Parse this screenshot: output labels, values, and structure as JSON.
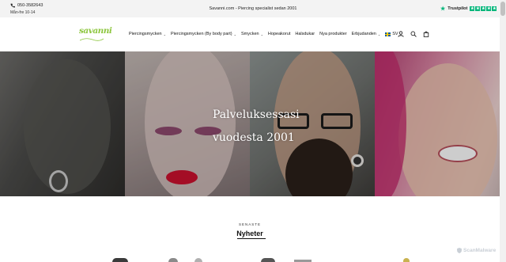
{
  "announcement": {
    "phone": "050-3582643",
    "hours": "Mån-fre 10-14",
    "message": "Savanni.com - Piercing specialist sedan 2001",
    "trustpilot_label": "Trustpilot",
    "trustpilot_star_count": 5,
    "trustpilot_color": "#00b67a"
  },
  "header": {
    "logo_text": "savanni",
    "nav": [
      {
        "label": "Piercingsmycken",
        "has_dropdown": true
      },
      {
        "label": "Piercingsmycken (By body part)",
        "has_dropdown": true
      },
      {
        "label": "Smycken",
        "has_dropdown": true
      },
      {
        "label": "Hopeakorut",
        "has_dropdown": false
      },
      {
        "label": "Halsdukar",
        "has_dropdown": false
      },
      {
        "label": "Nya produkter",
        "has_dropdown": false
      },
      {
        "label": "Erbjudanden",
        "has_dropdown": true
      }
    ],
    "language": "SV",
    "icons": [
      "user-icon",
      "search-icon",
      "cart-icon"
    ]
  },
  "hero": {
    "title_line1": "Palveluksessasi",
    "title_line2": "vuodesta 2001"
  },
  "latest": {
    "kicker": "SENASTE",
    "heading": "Nyheter"
  },
  "watermark": "ScanMalware",
  "colors": {
    "brand": "#8dc63f",
    "announcement_bg": "#f3f3f3"
  }
}
